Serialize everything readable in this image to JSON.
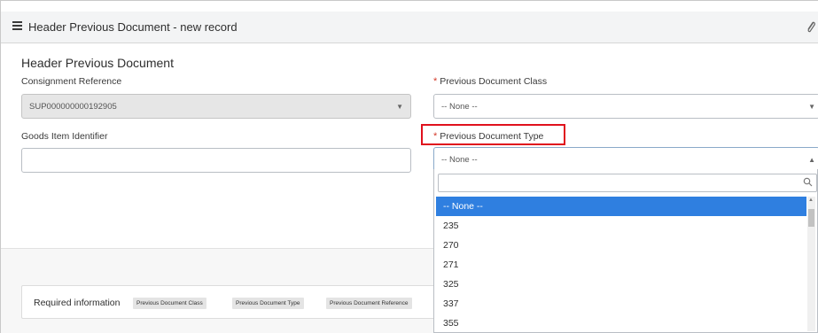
{
  "header": {
    "title": "Header Previous Document - new record"
  },
  "form": {
    "section_title": "Header Previous Document",
    "consignment_reference": {
      "label": "Consignment Reference",
      "value": "SUP000000000192905"
    },
    "previous_document_class": {
      "label": "Previous Document Class",
      "required_mark": "*",
      "value": "-- None --"
    },
    "goods_item_identifier": {
      "label": "Goods Item Identifier",
      "value": ""
    },
    "previous_document_type": {
      "label": "Previous Document Type",
      "required_mark": "*",
      "value": "-- None --"
    }
  },
  "dropdown": {
    "search_value": "",
    "options": [
      "-- None --",
      "235",
      "270",
      "271",
      "325",
      "337",
      "355"
    ],
    "selected_index": 0
  },
  "required_info": {
    "label": "Required information",
    "tags": [
      "Previous Document Class",
      "Previous Document Type",
      "Previous Document Reference"
    ]
  },
  "colors": {
    "highlight": "#e0111d",
    "selected": "#2f7fe0",
    "required": "#d43a2a"
  }
}
